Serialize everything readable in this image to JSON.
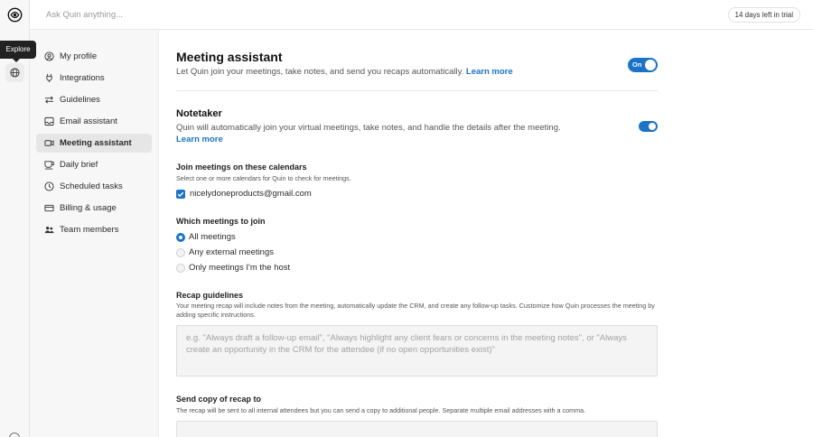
{
  "topbar": {
    "search_placeholder": "Ask Quin anything...",
    "trial_badge": "14 days left in trial"
  },
  "rail": {
    "tooltip": "Explore",
    "icons": [
      "quin-logo-icon",
      "globe-icon",
      "help-icon"
    ]
  },
  "nav": {
    "items": [
      {
        "label": "My profile",
        "icon": "user-circle-icon"
      },
      {
        "label": "Integrations",
        "icon": "plug-icon"
      },
      {
        "label": "Guidelines",
        "icon": "arrows-icon"
      },
      {
        "label": "Email assistant",
        "icon": "inbox-icon"
      },
      {
        "label": "Meeting assistant",
        "icon": "video-icon",
        "active": true
      },
      {
        "label": "Daily brief",
        "icon": "cup-icon"
      },
      {
        "label": "Scheduled tasks",
        "icon": "clock-icon"
      },
      {
        "label": "Billing & usage",
        "icon": "card-icon"
      },
      {
        "label": "Team members",
        "icon": "team-icon"
      }
    ]
  },
  "main": {
    "title": "Meeting assistant",
    "description": "Let Quin join your meetings, take notes, and send you recaps automatically.",
    "learn_more": "Learn more",
    "master_toggle": {
      "label": "On",
      "state": "on"
    },
    "notetaker": {
      "title": "Notetaker",
      "description": "Quin will automatically join your virtual meetings, take notes, and handle the details after the meeting.",
      "learn_more": "Learn more",
      "toggle_state": "on"
    },
    "calendars": {
      "title": "Join meetings on these calendars",
      "subtitle": "Select one or more calendars for Quin to check for meetings.",
      "items": [
        {
          "label": "nicelydoneproducts@gmail.com",
          "checked": true
        }
      ]
    },
    "which_meetings": {
      "title": "Which meetings to join",
      "options": [
        {
          "label": "All meetings",
          "selected": true
        },
        {
          "label": "Any external meetings",
          "selected": false
        },
        {
          "label": "Only meetings I'm the host",
          "selected": false
        }
      ]
    },
    "recap": {
      "title": "Recap guidelines",
      "description": "Your meeting recap will include notes from the meeting, automatically update the CRM, and create any follow-up tasks. Customize how Quin processes the meeting by adding specific instructions.",
      "placeholder": "e.g. \"Always draft a follow-up email\", \"Always highlight any client fears or concerns in the meeting notes\", or \"Always create an opportunity in the CRM for the attendee (if no open opportunities exist)\""
    },
    "send_copy": {
      "title": "Send copy of recap to",
      "description": "The recap will be sent to all internal attendees but you can send a copy to additional people. Separate multiple email addresses with a comma."
    }
  },
  "colors": {
    "accent": "#1a73c7"
  }
}
